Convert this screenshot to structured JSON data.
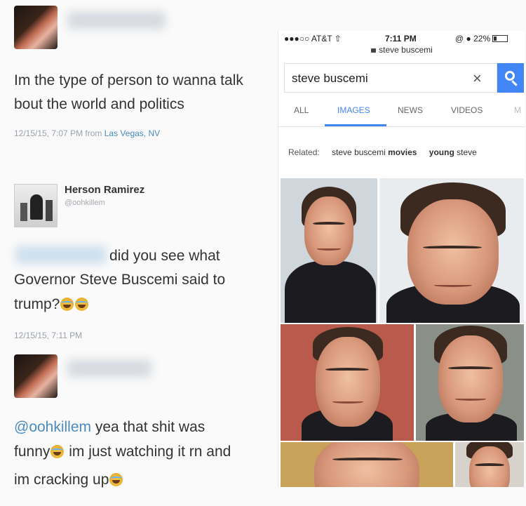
{
  "tweets": [
    {
      "text": "Im the type of person to wanna talk bout the world and politics",
      "meta": "12/15/15, 7:07 PM from ",
      "location": "Las Vegas, NV"
    },
    {
      "author_name": "Herson Ramirez",
      "author_handle": "@oohkillem",
      "text_line1": "did you see what",
      "text_line2": "Governor Steve Buscemi said to",
      "text_line3": "trump?",
      "meta": "12/15/15, 7:11 PM"
    },
    {
      "mention": "@oohkillem",
      "text_line1_rest": " yea that shit was",
      "text_line2_a": "funny",
      "text_line2_b": " im just watching it rn and",
      "text_line3": "im cracking up"
    }
  ],
  "phone": {
    "carrier": "●●●○○ AT&T ⇧",
    "time": "7:11 PM",
    "battery": "@ ● 22%",
    "url": "steve buscemi",
    "search_value": "steve buscemi",
    "clear_glyph": "×",
    "tabs": [
      "ALL",
      "IMAGES",
      "NEWS",
      "VIDEOS",
      "M"
    ],
    "related_label": "Related:",
    "related_chip1_a": "steve buscemi ",
    "related_chip1_b": "movies",
    "related_chip2_a": "young ",
    "related_chip2_b": "steve"
  },
  "colors": {
    "link": "#4b8bbf",
    "accent": "#4285f4"
  }
}
